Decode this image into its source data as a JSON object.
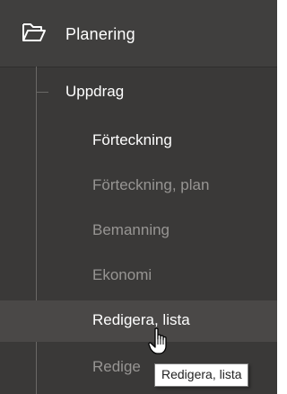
{
  "sidebar": {
    "header": {
      "label": "Planering",
      "icon": "folder-open-icon"
    },
    "section": {
      "label": "Uppdrag"
    },
    "items": [
      {
        "label": "Förteckning",
        "state": "active"
      },
      {
        "label": "Förteckning, plan",
        "state": "muted"
      },
      {
        "label": "Bemanning",
        "state": "muted"
      },
      {
        "label": "Ekonomi",
        "state": "muted"
      },
      {
        "label": "Redigera, lista",
        "state": "hover"
      },
      {
        "label": "Redige",
        "state": "muted"
      }
    ]
  },
  "tooltip": {
    "text": "Redigera, lista"
  },
  "colors": {
    "sidebar_bg": "#3a3938",
    "header_bg": "#403f3e",
    "hover_bg": "#4a4847",
    "active_text": "#ffffff",
    "muted_text": "#979593"
  }
}
